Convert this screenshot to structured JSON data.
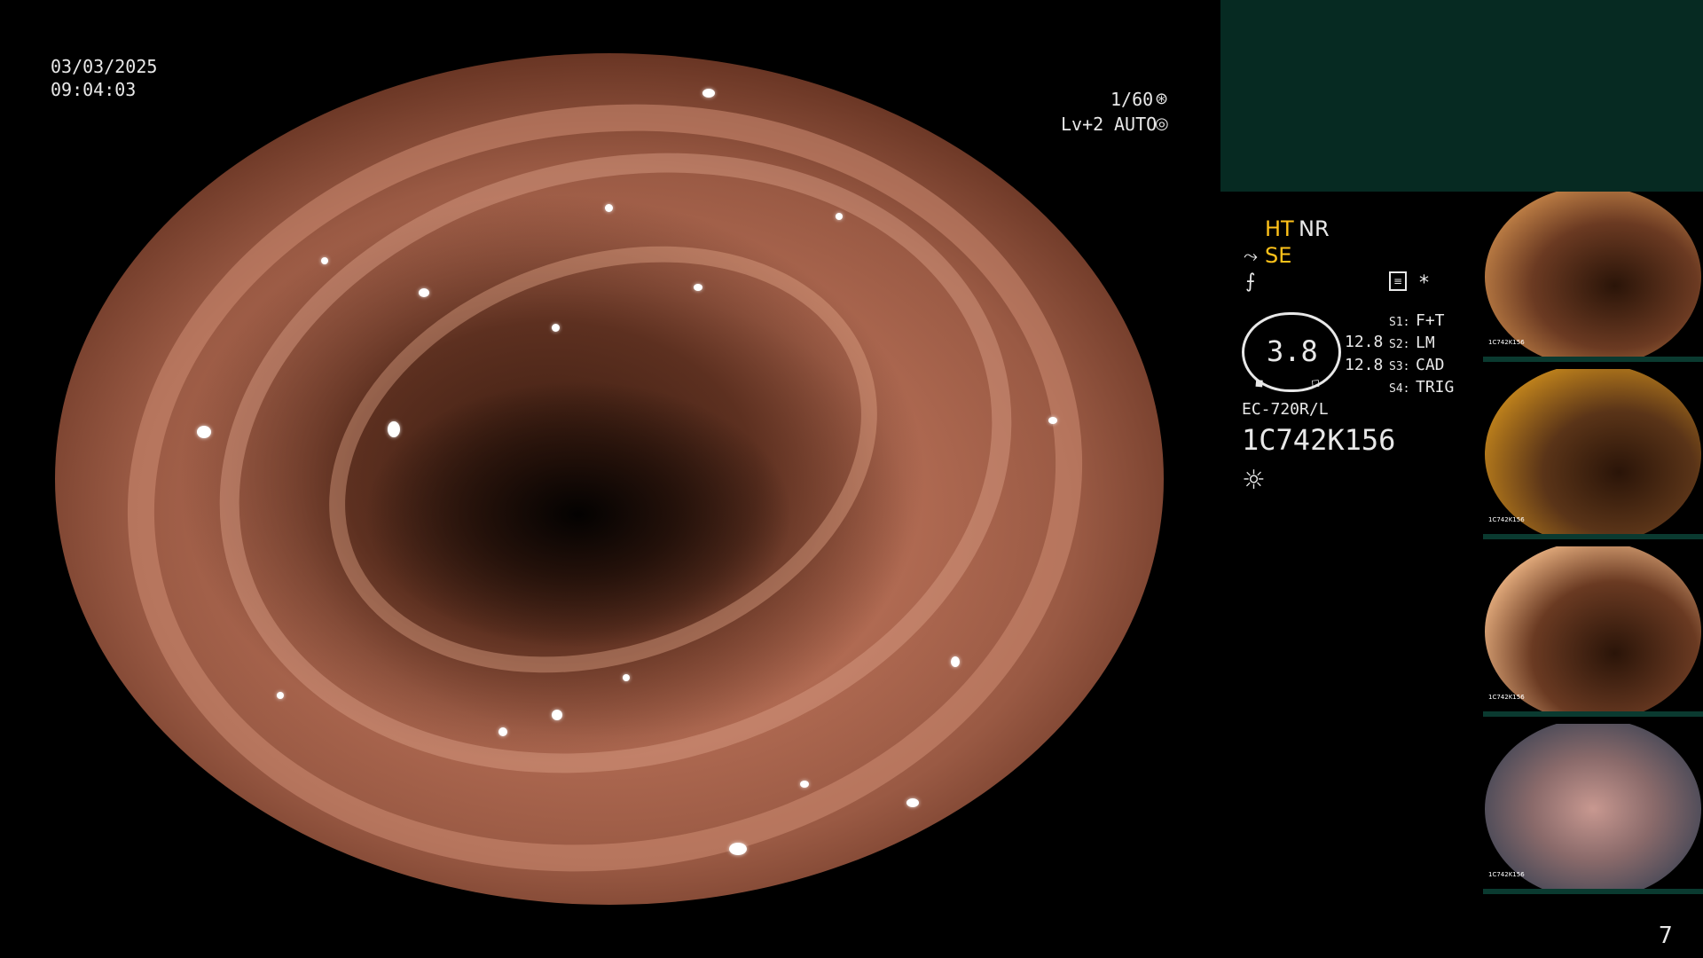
{
  "overlay": {
    "date": "03/03/2025",
    "time": "09:04:03",
    "shutter": "1/60",
    "level": "Lv+2",
    "iris": "AUTO"
  },
  "panel": {
    "ht": "HT",
    "nr": "NR",
    "se": "SE",
    "gauge_value": "3.8",
    "reading_1": "12.8",
    "reading_2": "12.8",
    "s1_label": "S1:",
    "s1_value": "F+T",
    "s2_label": "S2:",
    "s2_value": "LM",
    "s3_label": "S3:",
    "s3_value": "CAD",
    "s4_label": "S4:",
    "s4_value": "TRIG",
    "scope_model": "EC-720R/L",
    "serial": "1C742K156",
    "star": "*"
  },
  "thumbnails": [
    {
      "serial": "1C742K156",
      "tone": "#6b3a22"
    },
    {
      "serial": "1C742K156",
      "tone": "#8a5a20"
    },
    {
      "serial": "1C742K156",
      "tone": "#7a4a30"
    },
    {
      "serial": "1C742K156",
      "tone": "#5a5a66"
    }
  ],
  "page_number": "7",
  "colors": {
    "accent_yellow": "#ffc21a",
    "panel_green": "#062a22"
  }
}
